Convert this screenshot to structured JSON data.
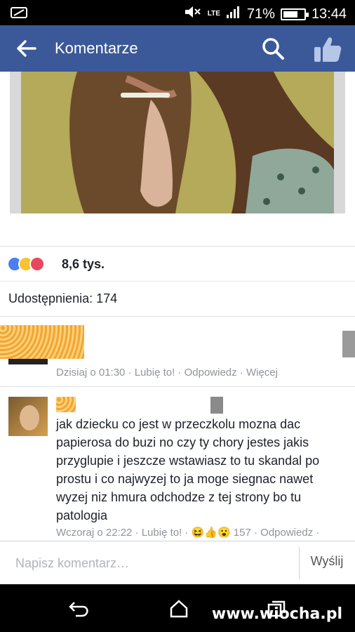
{
  "status_bar": {
    "network": "LTE",
    "battery_percent": "71%",
    "battery_level": 0.71,
    "time": "13:44"
  },
  "app_bar": {
    "title": "Komentarze"
  },
  "reactions": {
    "count": "8,6 tys.",
    "icons": [
      "like-reaction-icon",
      "haha-reaction-icon",
      "love-reaction-icon"
    ]
  },
  "shares": {
    "label": "Udostępnienia: 174"
  },
  "comments": [
    {
      "meta": "Dzisiaj o 01:30 · Lubię to! · Odpowiedz · Więcej"
    },
    {
      "text": "jak dziecku co jest w przeczkolu mozna dac papierosa do buzi no czy ty chory jestes jakis przyglupie i jeszcze wstawiasz to tu skandal po prostu i co najwyzej to ja moge siegnac nawet wyzej niz hmura odchodze z tej strony bo tu patologia",
      "meta": "Wczoraj o 22:22 · Lubię to! · 😆👍😮 157 · Odpowiedz ·"
    }
  ],
  "composer": {
    "placeholder": "Napisz komentarz…",
    "send_label": "Wyślij"
  },
  "watermark": "www.wiocha.pl",
  "colors": {
    "brand": "#3b5998",
    "like": "#4a7ef4",
    "haha": "#f7c233",
    "love": "#e8485f"
  }
}
